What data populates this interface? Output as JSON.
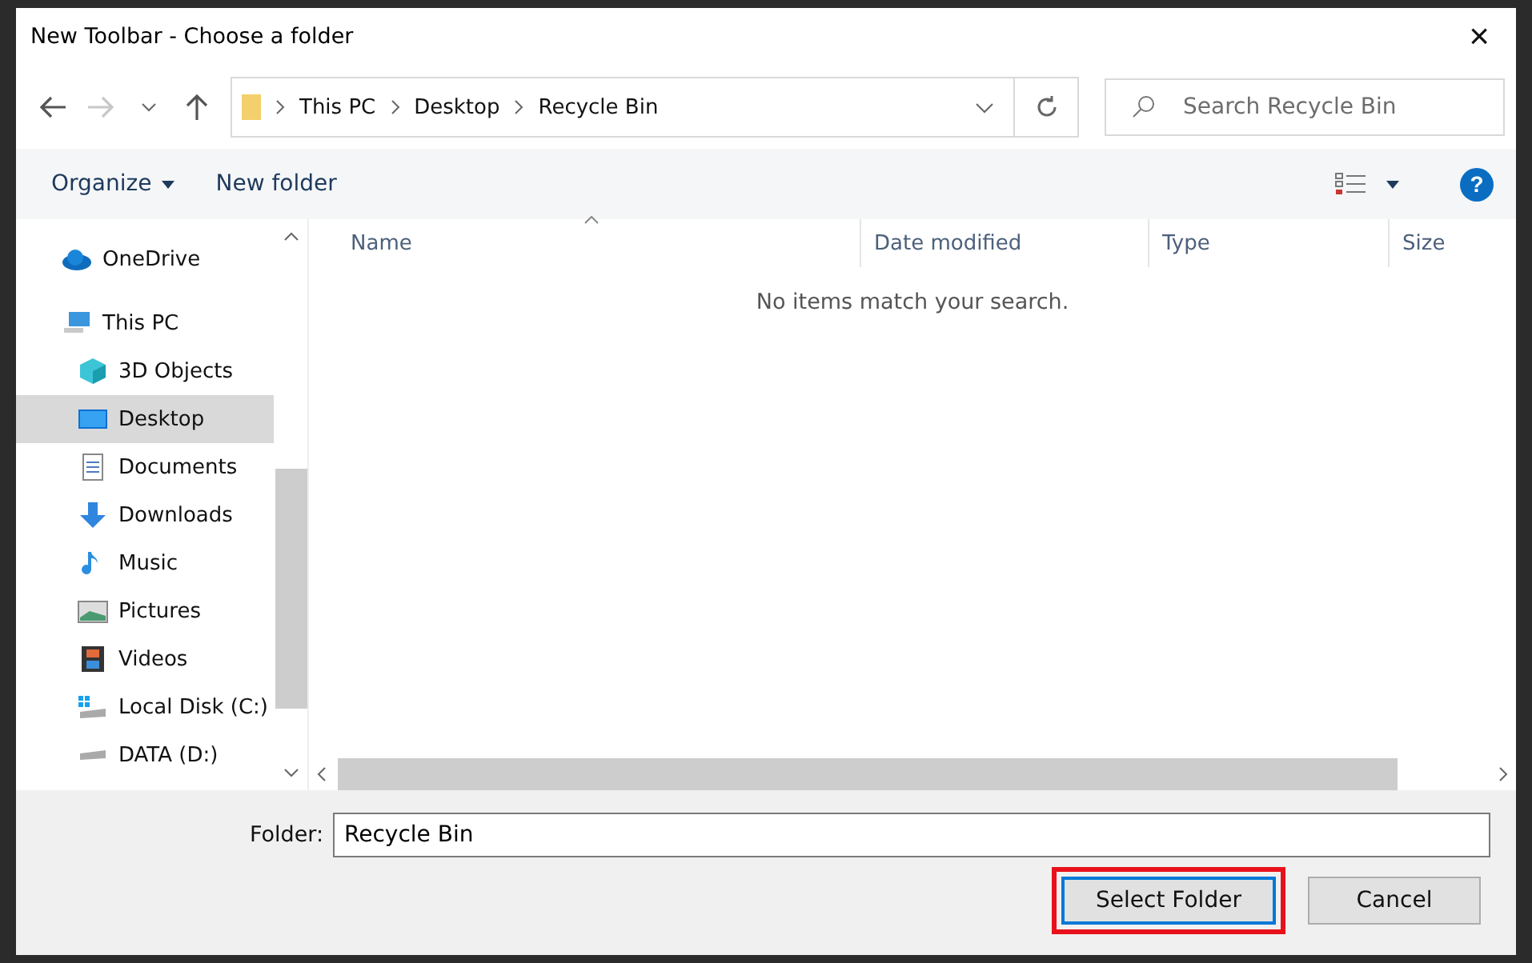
{
  "window": {
    "title": "New Toolbar - Choose a folder",
    "close": "×"
  },
  "nav": {
    "back_disabled": false,
    "forward_disabled": true,
    "breadcrumb": [
      "This PC",
      "Desktop",
      "Recycle Bin"
    ],
    "search": {
      "placeholder": "Search Recycle Bin"
    }
  },
  "toolbar": {
    "organize": "Organize",
    "new_folder": "New folder",
    "help": "?"
  },
  "sidebar": {
    "items": [
      {
        "label": "OneDrive",
        "selected": false
      },
      {
        "label": "This PC",
        "selected": false,
        "children": [
          {
            "label": "3D Objects",
            "selected": false
          },
          {
            "label": "Desktop",
            "selected": true
          },
          {
            "label": "Documents",
            "selected": false
          },
          {
            "label": "Downloads",
            "selected": false
          },
          {
            "label": "Music",
            "selected": false
          },
          {
            "label": "Pictures",
            "selected": false
          },
          {
            "label": "Videos",
            "selected": false
          },
          {
            "label": "Local Disk (C:)",
            "selected": false
          },
          {
            "label": "DATA (D:)",
            "selected": false
          }
        ]
      }
    ]
  },
  "table": {
    "columns": [
      {
        "label": "Name",
        "sorted": true
      },
      {
        "label": "Date modified",
        "sorted": false
      },
      {
        "label": "Type",
        "sorted": false
      },
      {
        "label": "Size",
        "sorted": false
      }
    ],
    "empty_message": "No items match your search."
  },
  "footer": {
    "folder_label": "Folder:",
    "folder_value": "Recycle Bin",
    "buttons": [
      {
        "label": "Select Folder",
        "default": true,
        "highlighted": true
      },
      {
        "label": "Cancel",
        "default": false,
        "highlighted": false
      }
    ]
  }
}
